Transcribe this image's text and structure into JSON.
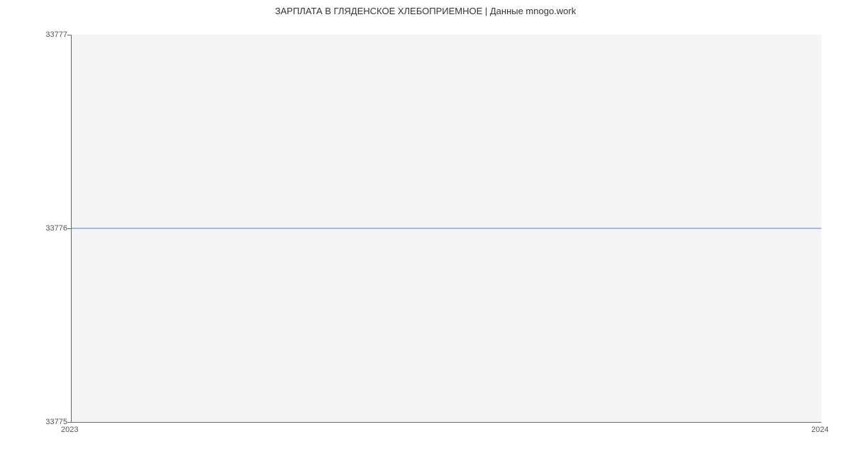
{
  "chart_data": {
    "type": "line",
    "title": "ЗАРПЛАТА В ГЛЯДЕНСКОЕ ХЛЕБОПРИЕМНОЕ | Данные mnogo.work",
    "x": [
      2023,
      2024
    ],
    "values": [
      33776,
      33776
    ],
    "xlabel": "",
    "ylabel": "",
    "xlim": [
      2023,
      2024
    ],
    "ylim": [
      33775,
      33777
    ],
    "y_ticks": [
      33775,
      33776,
      33777
    ],
    "x_ticks": [
      2023,
      2024
    ],
    "grid": false,
    "line_color": "#4a7fd6"
  }
}
